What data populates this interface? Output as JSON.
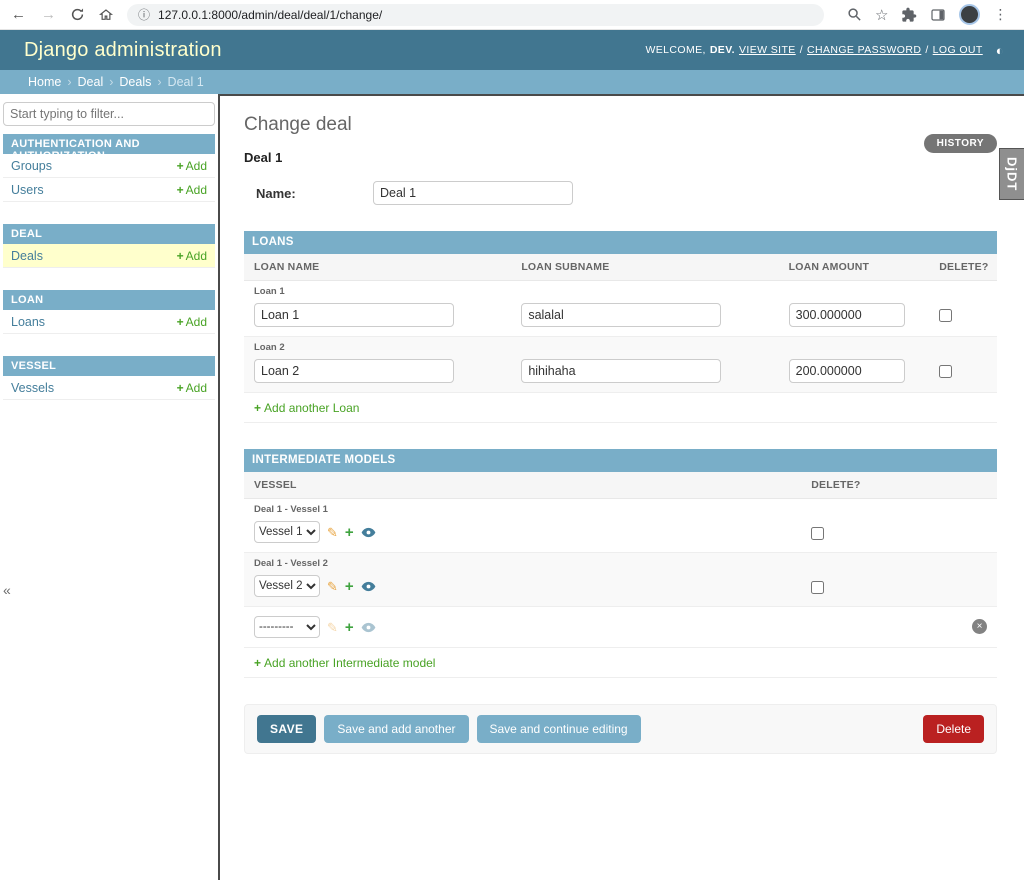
{
  "browser": {
    "url": "127.0.0.1:8000/admin/deal/deal/1/change/"
  },
  "icons": {
    "back": "←",
    "forward": "→",
    "info": "ⓘ",
    "star": "☆",
    "menu": "⋮",
    "theme": "◐",
    "pencil": "✎",
    "collapse": "«",
    "remove": "×",
    "breadcrumb_sep": "›",
    "tools_sep": "/",
    "add": "+"
  },
  "header": {
    "site_name": "Django administration",
    "welcome": "WELCOME,",
    "username": "DEV.",
    "view_site": "VIEW SITE",
    "change_password": "CHANGE PASSWORD",
    "log_out": "LOG OUT"
  },
  "breadcrumbs": {
    "items": [
      "Home",
      "Deal",
      "Deals",
      "Deal 1"
    ]
  },
  "sidebar": {
    "filter_placeholder": "Start typing to filter...",
    "add_label": "Add",
    "modules": [
      {
        "title": "AUTHENTICATION AND AUTHORIZATION",
        "rows": [
          {
            "label": "Groups"
          },
          {
            "label": "Users"
          }
        ]
      },
      {
        "title": "DEAL",
        "rows": [
          {
            "label": "Deals"
          }
        ]
      },
      {
        "title": "LOAN",
        "rows": [
          {
            "label": "Loans"
          }
        ]
      },
      {
        "title": "VESSEL",
        "rows": [
          {
            "label": "Vessels"
          }
        ]
      }
    ]
  },
  "main": {
    "page_title": "Change deal",
    "object_title": "Deal 1",
    "history_button": "HISTORY",
    "name_label": "Name:",
    "name_value": "Deal 1",
    "loans": {
      "title": "LOANS",
      "columns": {
        "name": "LOAN NAME",
        "subname": "LOAN SUBNAME",
        "amount": "LOAN AMOUNT",
        "delete": "DELETE?"
      },
      "rows": [
        {
          "caption": "Loan 1",
          "name": "Loan 1",
          "subname": "salalal",
          "amount": "300.000000"
        },
        {
          "caption": "Loan 2",
          "name": "Loan 2",
          "subname": "hihihaha",
          "amount": "200.000000"
        }
      ],
      "add_row": "Add another Loan"
    },
    "intermediates": {
      "title": "INTERMEDIATE MODELS",
      "columns": {
        "vessel": "VESSEL",
        "delete": "DELETE?"
      },
      "rows": [
        {
          "caption": "Deal 1 - Vessel 1",
          "selected": "Vessel 1"
        },
        {
          "caption": "Deal 1 - Vessel 2",
          "selected": "Vessel 2"
        }
      ],
      "new_row_value": "---------",
      "add_row": "Add another Intermediate model"
    },
    "submit": {
      "save": "SAVE",
      "save_add": "Save and add another",
      "save_continue": "Save and continue editing",
      "delete": "Delete"
    }
  },
  "djdt": {
    "label": "DjDT"
  },
  "colors": {
    "header_bg": "#417690",
    "accent": "#79aec8",
    "link": "#447e9b",
    "add_green": "#49a325",
    "selected_row": "#ffffcc",
    "delete_red": "#ba2121",
    "history_gray": "#757575"
  }
}
